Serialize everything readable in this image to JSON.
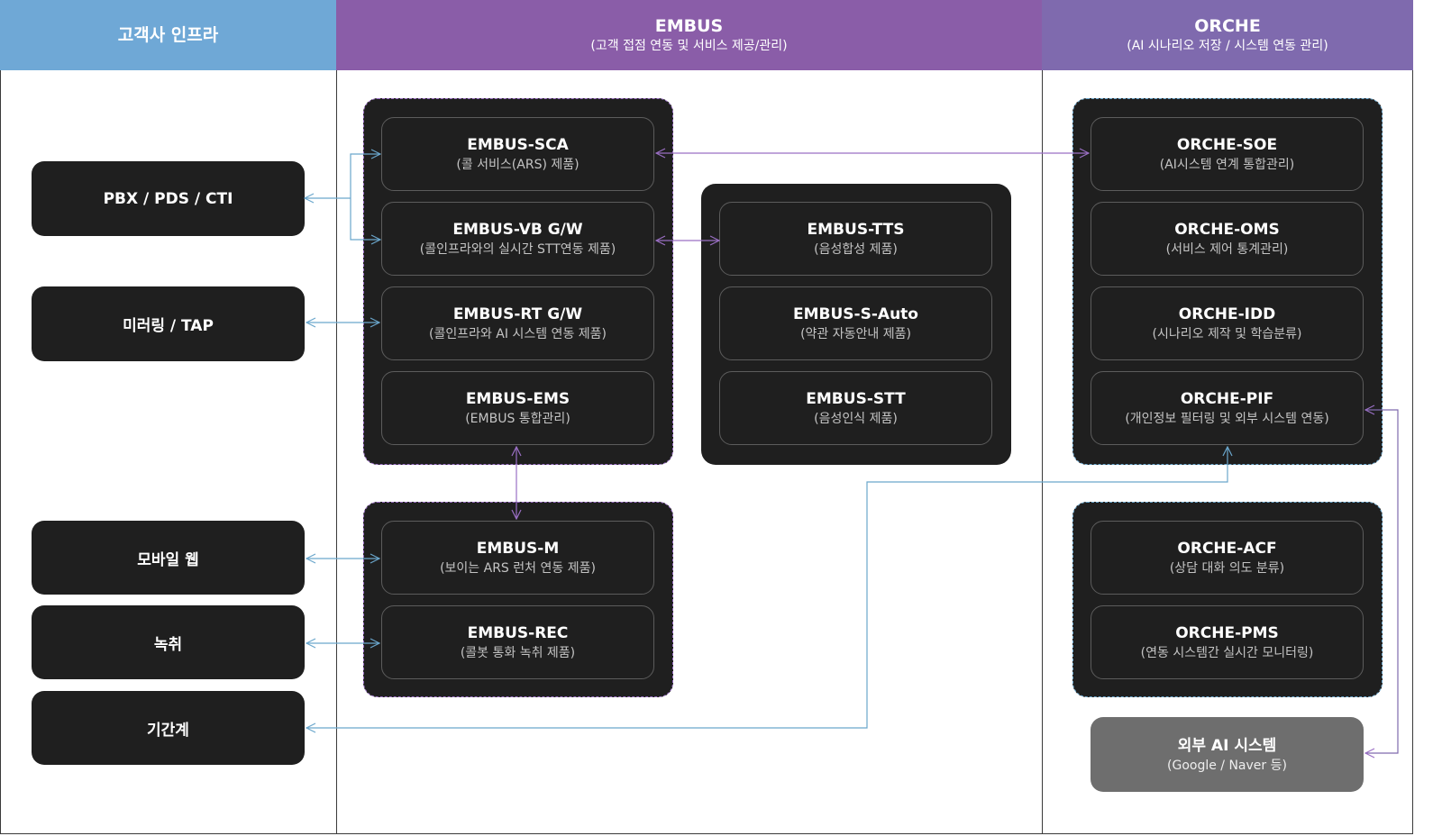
{
  "colors": {
    "customer_header": "#6fa8d6",
    "embus_header": "#8a5da8",
    "orche_header": "#7f6aae",
    "box_bg": "#1f1f1f",
    "external_bg": "#6e6e6e",
    "arrow_purple": "#9a6fc4",
    "arrow_blue": "#6aa6cc"
  },
  "columns": {
    "customer": {
      "title": "고객사 인프라"
    },
    "embus": {
      "title": "EMBUS",
      "subtitle": "(고객 접점 연동 및 서비스 제공/관리)"
    },
    "orche": {
      "title": "ORCHE",
      "subtitle": "(AI 시나리오 저장 / 시스템 연동 관리)"
    }
  },
  "customer_items": {
    "pbx": "PBX / PDS / CTI",
    "mirroring": "미러링 / TAP",
    "mobile_web": "모바일 웹",
    "recording": "녹취",
    "core_system": "기간계"
  },
  "embus": {
    "sca": {
      "name": "EMBUS-SCA",
      "desc": "(콜 서비스(ARS) 제품)"
    },
    "vb": {
      "name": "EMBUS-VB G/W",
      "desc": "(콜인프라와의 실시간 STT연동 제품)"
    },
    "rt": {
      "name": "EMBUS-RT G/W",
      "desc": "(콜인프라와 AI 시스템 연동 제품)"
    },
    "ems": {
      "name": "EMBUS-EMS",
      "desc": "(EMBUS 통합관리)"
    },
    "tts": {
      "name": "EMBUS-TTS",
      "desc": "(음성합성 제품)"
    },
    "sauto": {
      "name": "EMBUS-S-Auto",
      "desc": "(약관 자동안내 제품)"
    },
    "stt": {
      "name": "EMBUS-STT",
      "desc": "(음성인식 제품)"
    },
    "m": {
      "name": "EMBUS-M",
      "desc": "(보이는 ARS 런처 연동 제품)"
    },
    "rec": {
      "name": "EMBUS-REC",
      "desc": "(콜봇 통화 녹취 제품)"
    }
  },
  "orche": {
    "soe": {
      "name": "ORCHE-SOE",
      "desc": "(AI시스템 연계 통합관리)"
    },
    "oms": {
      "name": "ORCHE-OMS",
      "desc": "(서비스 제어 통계관리)"
    },
    "idd": {
      "name": "ORCHE-IDD",
      "desc": "(시나리오 제작 및 학습분류)"
    },
    "pif": {
      "name": "ORCHE-PIF",
      "desc": "(개인정보 필터링 및 외부 시스템 연동)"
    },
    "acf": {
      "name": "ORCHE-ACF",
      "desc": "(상담 대화 의도 분류)"
    },
    "pms": {
      "name": "ORCHE-PMS",
      "desc": "(연동 시스템간 실시간 모니터링)"
    }
  },
  "external": {
    "name": "외부 AI 시스템",
    "desc": "(Google / Naver 등)"
  }
}
